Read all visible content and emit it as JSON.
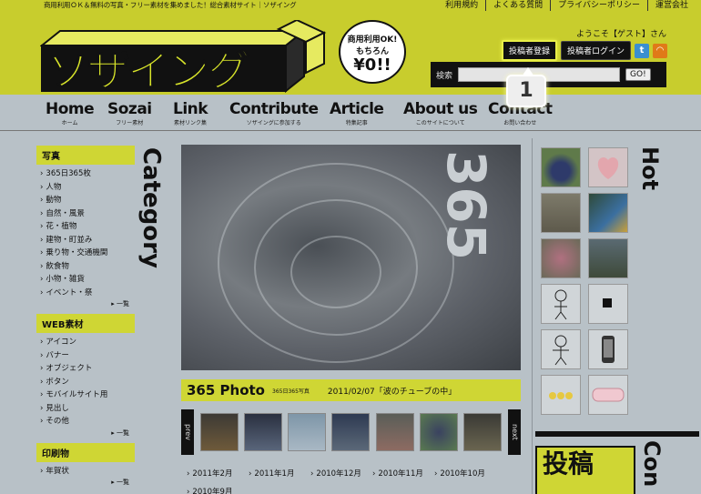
{
  "header": {
    "tagline": "商用利用ＯＫ＆無料の写真・フリー素材を集めました！総合素材サイト｜ソザイング",
    "top_links": [
      "利用規約",
      "よくある質問",
      "プライバシーポリシー",
      "運営会社"
    ],
    "logo_text": "ソザイング",
    "bubble": {
      "line1": "商用利用OK!",
      "line2": "もちろん",
      "line3": "¥0!!"
    },
    "welcome": "ようこそ【ゲスト】さん",
    "register_button": "投稿者登録",
    "login_button": "投稿者ログイン",
    "social": {
      "twitter": "t",
      "rss": "◠"
    },
    "search": {
      "label": "検索",
      "value": "",
      "go": "GO!"
    },
    "callout_number": "1"
  },
  "nav": [
    {
      "main": "Home",
      "sub": "ホーム"
    },
    {
      "main": "Sozai",
      "sub": "フリー素材"
    },
    {
      "main": "Link",
      "sub": "素材リンク集"
    },
    {
      "main": "Contribute",
      "sub": "ソザイングに参加する"
    },
    {
      "main": "Article",
      "sub": "特集記事"
    },
    {
      "main": "About us",
      "sub": "このサイトについて"
    },
    {
      "main": "Contact",
      "sub": "お問い合わせ"
    }
  ],
  "sidebar": {
    "category_label": "Category",
    "sections": [
      {
        "title": "写真",
        "items": [
          "365日365枚",
          "人物",
          "動物",
          "自然・風景",
          "花・植物",
          "建物・町並み",
          "乗り物・交通機関",
          "飲食物",
          "小物・雑貨",
          "イベント・祭"
        ],
        "more": "▸ 一覧"
      },
      {
        "title": "WEB素材",
        "items": [
          "アイコン",
          "バナー",
          "オブジェクト",
          "ボタン",
          "モバイルサイト用",
          "見出し",
          "その他"
        ],
        "more": "▸ 一覧"
      },
      {
        "title": "印刷物",
        "items": [
          "年賀状"
        ],
        "more": "▸ 一覧"
      }
    ]
  },
  "main": {
    "photo_number": "365",
    "p365_title": "365 Photo",
    "p365_sub": "365日365写真",
    "p365_date": "2011/02/07「波のチューブの中」",
    "prev_label": "prev",
    "next_label": "next",
    "months": [
      "2011年2月",
      "2011年1月",
      "2010年12月",
      "2010年11月",
      "2010年10月",
      "2010年9月"
    ]
  },
  "right": {
    "hot_label": "Hot",
    "post_label": "投稿",
    "contribute_label": "Con"
  },
  "colors": {
    "accent": "#cfd634",
    "header_bg": "#c8cd2d",
    "dim_bg": "#b8c1c7"
  }
}
